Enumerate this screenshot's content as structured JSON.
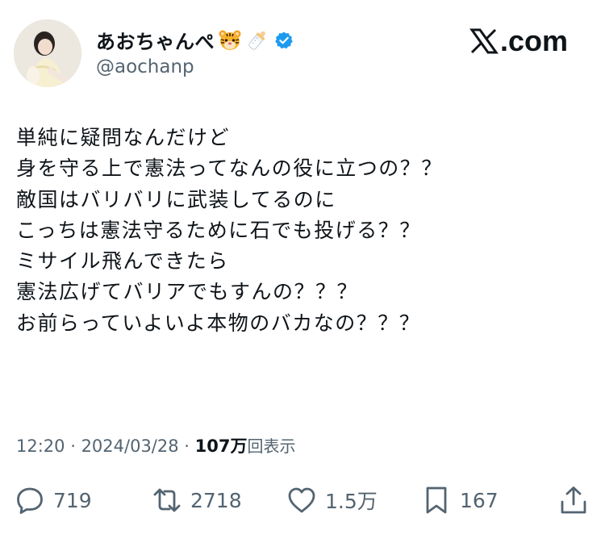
{
  "author": {
    "display_name": "あおちゃんぺ",
    "emoji_1": "tiger-face-emoji",
    "emoji_2": "baby-bottle-emoji",
    "verified_icon": "verified-badge-icon",
    "handle": "@aochanp",
    "avatar": "profile-photo"
  },
  "brand": {
    "label": ".com",
    "icon": "x-logo-icon"
  },
  "tweet": {
    "lines": [
      "単純に疑問なんだけど",
      "身を守る上で憲法ってなんの役に立つの？？",
      "敵国はバリバリに武装してるのに",
      "こっちは憲法守るために石でも投げる？？",
      "ミサイル飛んできたら",
      "憲法広げてバリアでもすんの？？？",
      "お前らっていよいよ本物のバカなの？？？"
    ]
  },
  "meta": {
    "time": "12:20",
    "separator": " · ",
    "date": "2024/03/28",
    "views_count": "107万",
    "views_label": "回表示"
  },
  "actions": {
    "replies": "719",
    "reposts": "2718",
    "likes": "1.5万",
    "bookmarks": "167"
  },
  "colors": {
    "text": "#0f1419",
    "secondary": "#536471",
    "verified": "#1d9bf0"
  }
}
